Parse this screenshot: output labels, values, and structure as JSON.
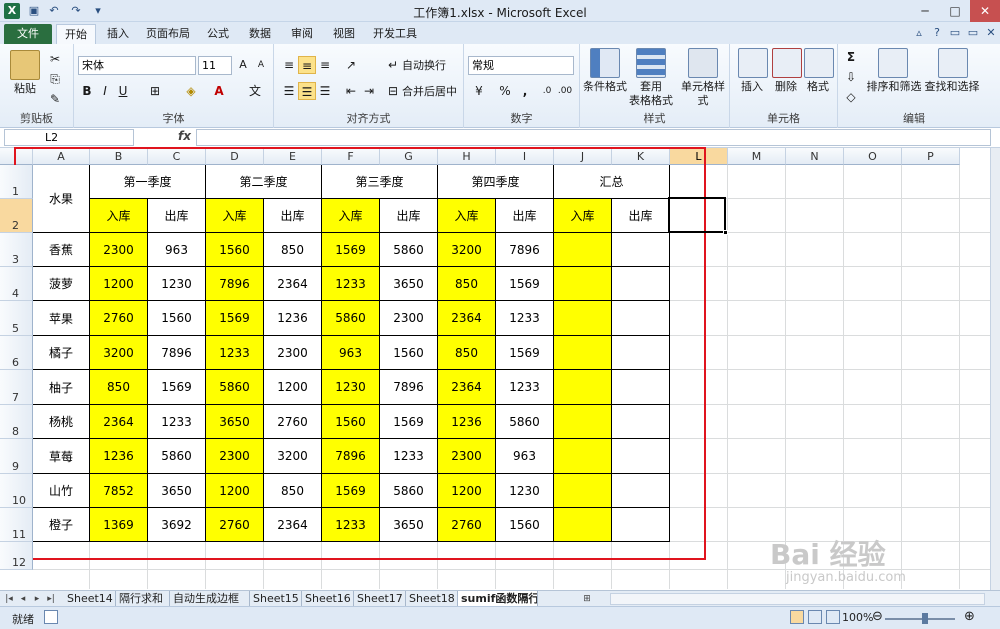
{
  "window": {
    "title": "工作簿1.xlsx - Microsoft Excel",
    "controls": [
      "─",
      "□",
      "✕"
    ]
  },
  "ribbon_tabs": [
    "文件",
    "开始",
    "插入",
    "页面布局",
    "公式",
    "数据",
    "审阅",
    "视图",
    "开发工具"
  ],
  "ribbon": {
    "clipboard": {
      "paste": "粘贴",
      "label": "剪贴板"
    },
    "font": {
      "name": "宋体",
      "size": "11",
      "bold": "B",
      "italic": "I",
      "underline": "U",
      "label": "字体"
    },
    "alignment": {
      "wrap": "自动换行",
      "merge": "合并后居中",
      "label": "对齐方式"
    },
    "number": {
      "format": "常规",
      "percent": "%",
      "comma": ",",
      "label": "数字"
    },
    "styles": {
      "cond": "条件格式",
      "table1": "套用",
      "table2": "表格格式",
      "cell": "单元格样式",
      "label": "样式"
    },
    "cells": {
      "insert": "插入",
      "delete": "删除",
      "format": "格式",
      "label": "单元格"
    },
    "editing": {
      "sigma": "Σ",
      "sort": "排序和筛选",
      "find": "查找和选择",
      "label": "编辑"
    }
  },
  "formula_bar": {
    "name_box": "L2",
    "fx": "fx",
    "value": ""
  },
  "columns": [
    "A",
    "B",
    "C",
    "D",
    "E",
    "F",
    "G",
    "H",
    "I",
    "J",
    "K",
    "L",
    "M",
    "N",
    "O",
    "P"
  ],
  "selected_column": "L",
  "selected_row": "2",
  "rows": [
    "1",
    "2",
    "3",
    "4",
    "5",
    "6",
    "7",
    "8",
    "9",
    "10",
    "11",
    "12"
  ],
  "table": {
    "fruit_header": "水果",
    "quarters": [
      "第一季度",
      "第二季度",
      "第三季度",
      "第四季度",
      "汇总"
    ],
    "in_label": "入库",
    "out_label": "出库",
    "data": [
      {
        "fruit": "香蕉",
        "values": [
          "2300",
          "963",
          "1560",
          "850",
          "1569",
          "5860",
          "3200",
          "7896"
        ]
      },
      {
        "fruit": "菠萝",
        "values": [
          "1200",
          "1230",
          "7896",
          "2364",
          "1233",
          "3650",
          "850",
          "1569"
        ]
      },
      {
        "fruit": "苹果",
        "values": [
          "2760",
          "1560",
          "1569",
          "1236",
          "5860",
          "2300",
          "2364",
          "1233"
        ]
      },
      {
        "fruit": "橘子",
        "values": [
          "3200",
          "7896",
          "1233",
          "2300",
          "963",
          "1560",
          "850",
          "1569"
        ]
      },
      {
        "fruit": "柚子",
        "values": [
          "850",
          "1569",
          "5860",
          "1200",
          "1230",
          "7896",
          "2364",
          "1233"
        ]
      },
      {
        "fruit": "杨桃",
        "values": [
          "2364",
          "1233",
          "3650",
          "2760",
          "1560",
          "1569",
          "1236",
          "5860"
        ]
      },
      {
        "fruit": "草莓",
        "values": [
          "1236",
          "5860",
          "2300",
          "3200",
          "7896",
          "1233",
          "2300",
          "963"
        ]
      },
      {
        "fruit": "山竹",
        "values": [
          "7852",
          "3650",
          "1200",
          "850",
          "1569",
          "5860",
          "1200",
          "1230"
        ]
      },
      {
        "fruit": "橙子",
        "values": [
          "1369",
          "3692",
          "2760",
          "2364",
          "1233",
          "3650",
          "2760",
          "1560"
        ]
      }
    ]
  },
  "sheet_tabs": [
    "Sheet14",
    "隔行求和",
    "自动生成边框",
    "Sheet15",
    "Sheet16",
    "Sheet17",
    "Sheet18",
    "sumif函数隔行求和"
  ],
  "active_sheet": "sumif函数隔行求和",
  "status": {
    "ready": "就绪",
    "zoom": "100%"
  },
  "watermark": {
    "brand": "Bai 经验",
    "url": "jingyan.baidu.com"
  },
  "colors": {
    "highlight": "#ffff00",
    "annotation": "#e0141e",
    "excel_green": "#2a6e3f"
  }
}
